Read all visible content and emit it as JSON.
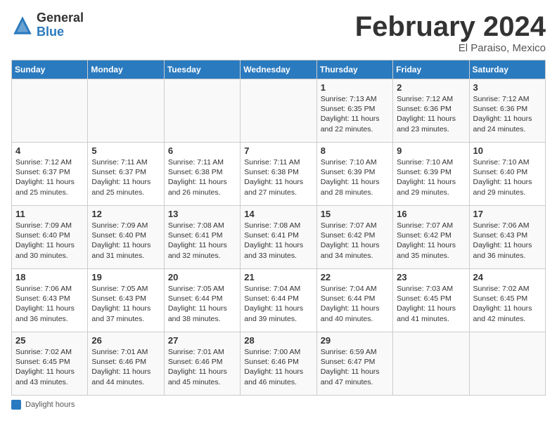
{
  "header": {
    "logo_general": "General",
    "logo_blue": "Blue",
    "month_title": "February 2024",
    "location": "El Paraiso, Mexico"
  },
  "days_of_week": [
    "Sunday",
    "Monday",
    "Tuesday",
    "Wednesday",
    "Thursday",
    "Friday",
    "Saturday"
  ],
  "weeks": [
    [
      {
        "num": "",
        "info": ""
      },
      {
        "num": "",
        "info": ""
      },
      {
        "num": "",
        "info": ""
      },
      {
        "num": "",
        "info": ""
      },
      {
        "num": "1",
        "info": "Sunrise: 7:13 AM\nSunset: 6:35 PM\nDaylight: 11 hours and 22 minutes."
      },
      {
        "num": "2",
        "info": "Sunrise: 7:12 AM\nSunset: 6:36 PM\nDaylight: 11 hours and 23 minutes."
      },
      {
        "num": "3",
        "info": "Sunrise: 7:12 AM\nSunset: 6:36 PM\nDaylight: 11 hours and 24 minutes."
      }
    ],
    [
      {
        "num": "4",
        "info": "Sunrise: 7:12 AM\nSunset: 6:37 PM\nDaylight: 11 hours and 25 minutes."
      },
      {
        "num": "5",
        "info": "Sunrise: 7:11 AM\nSunset: 6:37 PM\nDaylight: 11 hours and 25 minutes."
      },
      {
        "num": "6",
        "info": "Sunrise: 7:11 AM\nSunset: 6:38 PM\nDaylight: 11 hours and 26 minutes."
      },
      {
        "num": "7",
        "info": "Sunrise: 7:11 AM\nSunset: 6:38 PM\nDaylight: 11 hours and 27 minutes."
      },
      {
        "num": "8",
        "info": "Sunrise: 7:10 AM\nSunset: 6:39 PM\nDaylight: 11 hours and 28 minutes."
      },
      {
        "num": "9",
        "info": "Sunrise: 7:10 AM\nSunset: 6:39 PM\nDaylight: 11 hours and 29 minutes."
      },
      {
        "num": "10",
        "info": "Sunrise: 7:10 AM\nSunset: 6:40 PM\nDaylight: 11 hours and 29 minutes."
      }
    ],
    [
      {
        "num": "11",
        "info": "Sunrise: 7:09 AM\nSunset: 6:40 PM\nDaylight: 11 hours and 30 minutes."
      },
      {
        "num": "12",
        "info": "Sunrise: 7:09 AM\nSunset: 6:40 PM\nDaylight: 11 hours and 31 minutes."
      },
      {
        "num": "13",
        "info": "Sunrise: 7:08 AM\nSunset: 6:41 PM\nDaylight: 11 hours and 32 minutes."
      },
      {
        "num": "14",
        "info": "Sunrise: 7:08 AM\nSunset: 6:41 PM\nDaylight: 11 hours and 33 minutes."
      },
      {
        "num": "15",
        "info": "Sunrise: 7:07 AM\nSunset: 6:42 PM\nDaylight: 11 hours and 34 minutes."
      },
      {
        "num": "16",
        "info": "Sunrise: 7:07 AM\nSunset: 6:42 PM\nDaylight: 11 hours and 35 minutes."
      },
      {
        "num": "17",
        "info": "Sunrise: 7:06 AM\nSunset: 6:43 PM\nDaylight: 11 hours and 36 minutes."
      }
    ],
    [
      {
        "num": "18",
        "info": "Sunrise: 7:06 AM\nSunset: 6:43 PM\nDaylight: 11 hours and 36 minutes."
      },
      {
        "num": "19",
        "info": "Sunrise: 7:05 AM\nSunset: 6:43 PM\nDaylight: 11 hours and 37 minutes."
      },
      {
        "num": "20",
        "info": "Sunrise: 7:05 AM\nSunset: 6:44 PM\nDaylight: 11 hours and 38 minutes."
      },
      {
        "num": "21",
        "info": "Sunrise: 7:04 AM\nSunset: 6:44 PM\nDaylight: 11 hours and 39 minutes."
      },
      {
        "num": "22",
        "info": "Sunrise: 7:04 AM\nSunset: 6:44 PM\nDaylight: 11 hours and 40 minutes."
      },
      {
        "num": "23",
        "info": "Sunrise: 7:03 AM\nSunset: 6:45 PM\nDaylight: 11 hours and 41 minutes."
      },
      {
        "num": "24",
        "info": "Sunrise: 7:02 AM\nSunset: 6:45 PM\nDaylight: 11 hours and 42 minutes."
      }
    ],
    [
      {
        "num": "25",
        "info": "Sunrise: 7:02 AM\nSunset: 6:45 PM\nDaylight: 11 hours and 43 minutes."
      },
      {
        "num": "26",
        "info": "Sunrise: 7:01 AM\nSunset: 6:46 PM\nDaylight: 11 hours and 44 minutes."
      },
      {
        "num": "27",
        "info": "Sunrise: 7:01 AM\nSunset: 6:46 PM\nDaylight: 11 hours and 45 minutes."
      },
      {
        "num": "28",
        "info": "Sunrise: 7:00 AM\nSunset: 6:46 PM\nDaylight: 11 hours and 46 minutes."
      },
      {
        "num": "29",
        "info": "Sunrise: 6:59 AM\nSunset: 6:47 PM\nDaylight: 11 hours and 47 minutes."
      },
      {
        "num": "",
        "info": ""
      },
      {
        "num": "",
        "info": ""
      }
    ]
  ],
  "footer": {
    "label": "Daylight hours"
  }
}
